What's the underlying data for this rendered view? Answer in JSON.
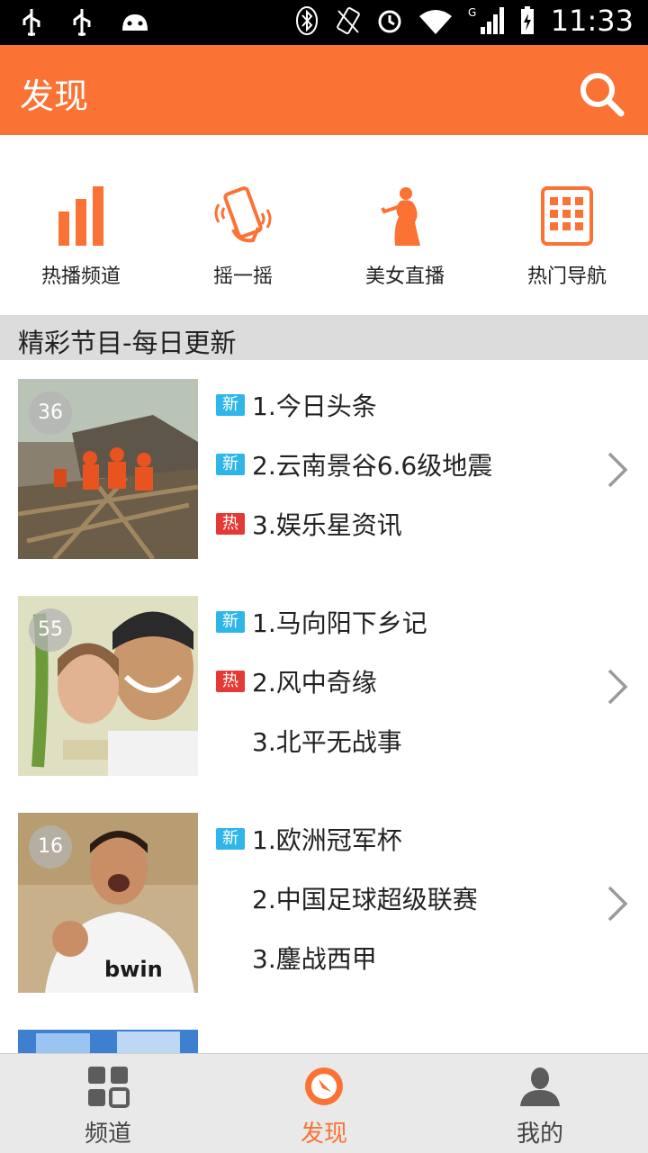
{
  "status_bar": {
    "time": "11:33",
    "network": "G"
  },
  "app_bar": {
    "title": "发现",
    "search_icon": "search-icon"
  },
  "shortcuts": [
    {
      "label": "热播频道",
      "icon": "bar-chart-icon"
    },
    {
      "label": "摇一摇",
      "icon": "shake-phone-icon"
    },
    {
      "label": "美女直播",
      "icon": "woman-silhouette-icon"
    },
    {
      "label": "热门导航",
      "icon": "grid-phone-icon"
    }
  ],
  "section": {
    "title": "精彩节目-每日更新"
  },
  "rows": [
    {
      "badge": "36",
      "items": [
        {
          "tag": "new",
          "tag_label": "新",
          "text": "1.今日头条"
        },
        {
          "tag": "new",
          "tag_label": "新",
          "text": "2.云南景谷6.6级地震"
        },
        {
          "tag": "hot",
          "tag_label": "热",
          "text": "3.娱乐星资讯"
        }
      ]
    },
    {
      "badge": "55",
      "items": [
        {
          "tag": "new",
          "tag_label": "新",
          "text": "1.马向阳下乡记"
        },
        {
          "tag": "hot",
          "tag_label": "热",
          "text": "2.风中奇缘"
        },
        {
          "tag": "none",
          "tag_label": "",
          "text": "3.北平无战事"
        }
      ]
    },
    {
      "badge": "16",
      "items": [
        {
          "tag": "new",
          "tag_label": "新",
          "text": "1.欧洲冠军杯"
        },
        {
          "tag": "none",
          "tag_label": "",
          "text": "2.中国足球超级联赛"
        },
        {
          "tag": "none",
          "tag_label": "",
          "text": "3.鏖战西甲"
        }
      ]
    }
  ],
  "bottom_nav": [
    {
      "label": "频道",
      "icon": "grid-icon",
      "active": false
    },
    {
      "label": "发现",
      "icon": "compass-icon",
      "active": true
    },
    {
      "label": "我的",
      "icon": "person-icon",
      "active": false
    }
  ],
  "colors": {
    "accent": "#fb7235",
    "new_tag": "#2fb6e8",
    "hot_tag": "#e53935",
    "inactive": "#555555"
  }
}
